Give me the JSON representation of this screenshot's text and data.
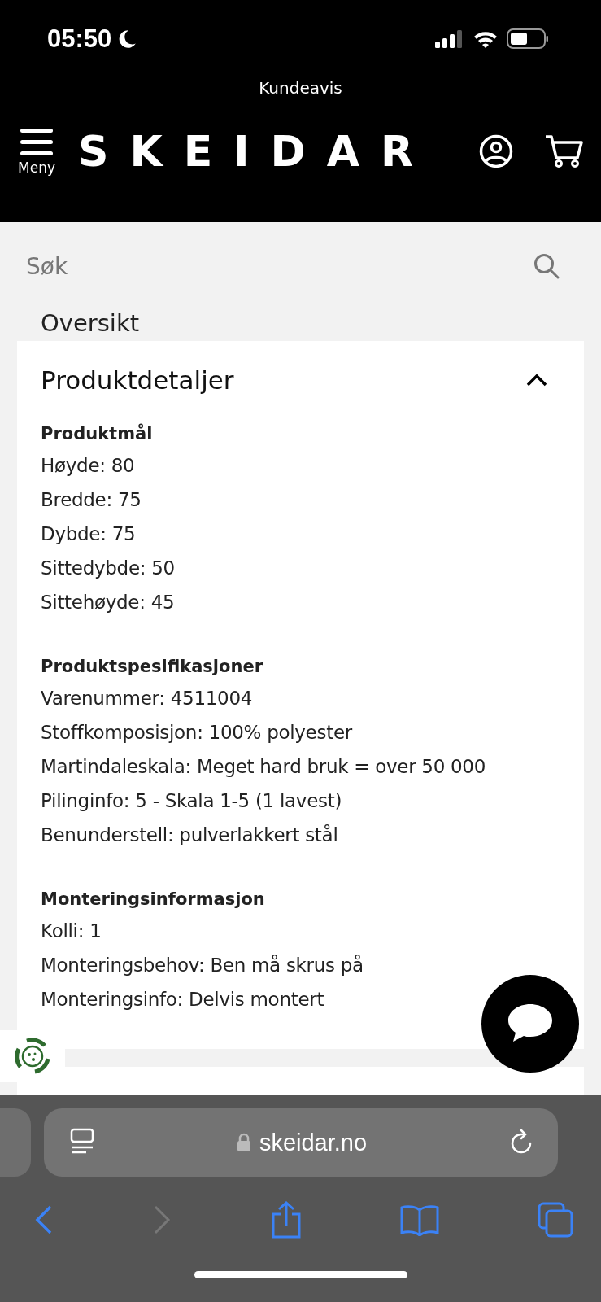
{
  "status_bar": {
    "time": "05:50"
  },
  "top_banner": {
    "label": "Kundeavis"
  },
  "header": {
    "menu_label": "Meny",
    "logo": "SKEIDAR"
  },
  "search": {
    "placeholder": "Søk"
  },
  "section_above": {
    "title": "Oversikt"
  },
  "product_details": {
    "title": "Produktdetaljer",
    "expanded": true,
    "groups": [
      {
        "heading": "Produktmål",
        "lines": [
          "Høyde: 80",
          "Bredde: 75",
          "Dybde: 75",
          "Sittedybde: 50",
          "Sittehøyde: 45"
        ]
      },
      {
        "heading": "Produktspesifikasjoner",
        "lines": [
          "Varenummer: 4511004",
          "Stoffkomposisjon: 100% polyester",
          "Martindaleskala: Meget hard bruk = over 50 000",
          "Pilinginfo: 5 - Skala 1-5 (1 lavest)",
          "Benunderstell: pulverlakkert stål"
        ]
      },
      {
        "heading": "Monteringsinformasjon",
        "lines": [
          "Kolli: 1",
          "Monteringsbehov: Ben må skrus på",
          "Monteringsinfo: Delvis montert"
        ]
      }
    ]
  },
  "browser": {
    "url": "skeidar.no"
  }
}
